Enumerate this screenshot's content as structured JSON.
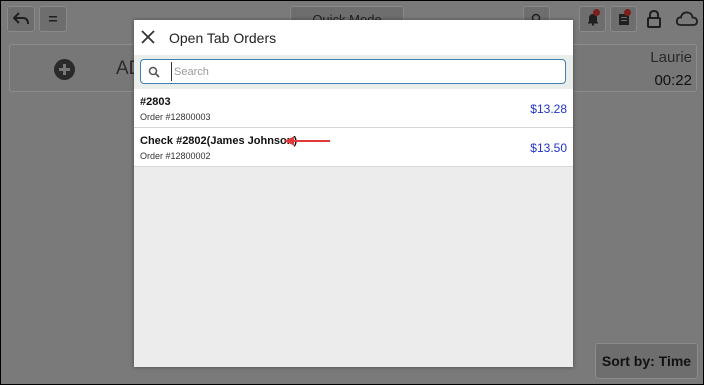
{
  "topbar": {
    "back_icon": "back-arrow-icon",
    "menu_icon": "menu-icon",
    "quick_mode_label": "Quick Mode",
    "search_icon": "search-icon",
    "notification_icon": "bell-icon",
    "orders_icon": "receipt-icon",
    "lock_icon": "lock-icon",
    "cloud_icon": "cloud-icon",
    "badge_color": "#7a1f1a"
  },
  "customer_bar": {
    "add_label": "AD",
    "server_name": "Laurie",
    "timer": "00:22"
  },
  "sort_button": {
    "label": "Sort by: Time"
  },
  "modal": {
    "title": "Open Tab Orders",
    "close_icon": "close-icon",
    "search": {
      "placeholder": "Search",
      "value": ""
    },
    "orders": [
      {
        "name": "#2803",
        "order_number": "Order #12800003",
        "amount": "$13.28"
      },
      {
        "name": "Check #2802(James Johnson)",
        "order_number": "Order #12800002",
        "amount": "$13.50",
        "annotated": true
      }
    ],
    "annotation_arrow_color": "#e03a3a",
    "amount_color": "#2233cc",
    "search_border_color": "#3f7fb5"
  }
}
